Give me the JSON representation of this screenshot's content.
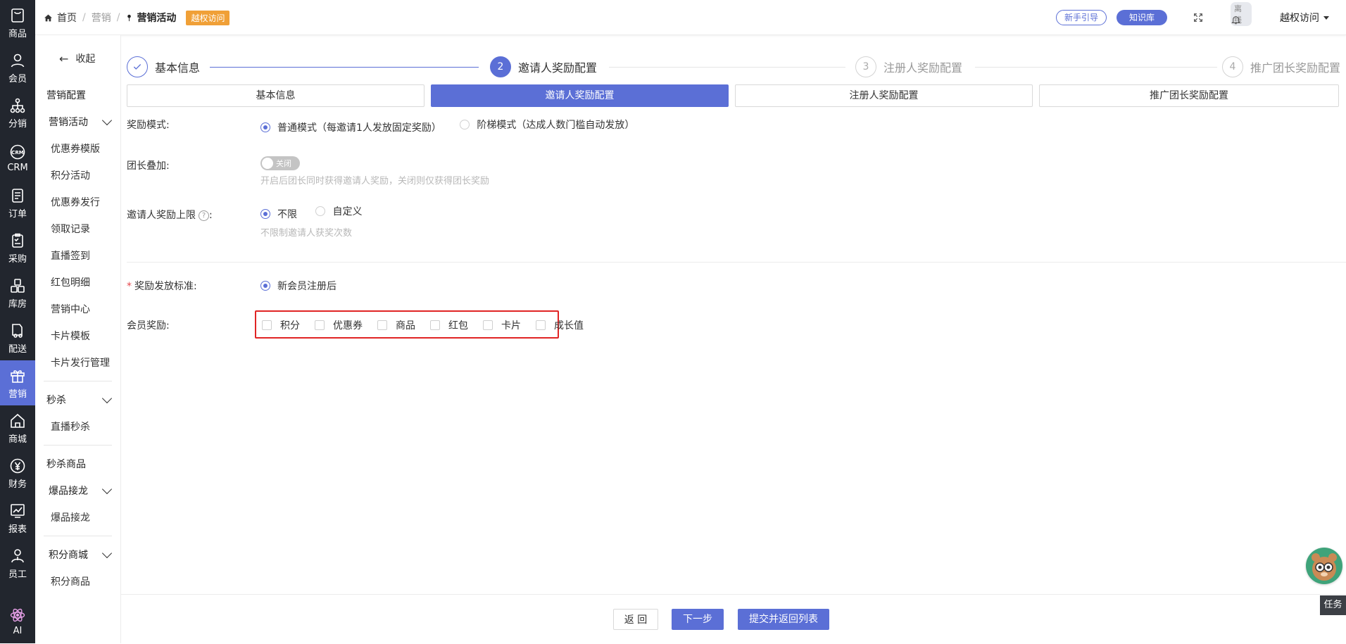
{
  "rail": {
    "items": [
      {
        "label": "商品",
        "icon": "bag-icon"
      },
      {
        "label": "会员",
        "icon": "user-icon"
      },
      {
        "label": "分销",
        "icon": "network-icon"
      },
      {
        "label": "CRM",
        "icon": "crm-icon"
      },
      {
        "label": "订单",
        "icon": "order-icon"
      },
      {
        "label": "采购",
        "icon": "purchase-icon"
      },
      {
        "label": "库房",
        "icon": "warehouse-icon"
      },
      {
        "label": "配送",
        "icon": "delivery-icon"
      },
      {
        "label": "营销",
        "icon": "gift-icon",
        "active": true
      },
      {
        "label": "商城",
        "icon": "home-icon"
      },
      {
        "label": "财务",
        "icon": "yuan-icon"
      },
      {
        "label": "报表",
        "icon": "chart-icon"
      },
      {
        "label": "员工",
        "icon": "staff-icon"
      }
    ],
    "ai_label": "AI"
  },
  "topbar": {
    "breadcrumb": [
      "首页",
      "营销",
      "营销活动"
    ],
    "badge": "越权访问",
    "guide_button": "新手引导",
    "knowledge_button": "知识库",
    "offline_tag": "离线",
    "user_menu": "越权访问"
  },
  "sidebar": {
    "collapse": "收起",
    "marketing_config": "营销配置",
    "group_activity": "营销活动",
    "activity_items": [
      "优惠券模版",
      "积分活动",
      "优惠券发行",
      "领取记录",
      "直播签到",
      "红包明细",
      "营销中心",
      "卡片模板",
      "卡片发行管理"
    ],
    "group_seckill": "秒杀",
    "seckill_items": [
      "直播秒杀"
    ],
    "seckill_goods": "秒杀商品",
    "group_chain": "爆品接龙",
    "chain_items": [
      "爆品接龙"
    ],
    "group_points": "积分商城",
    "points_items": [
      "积分商品"
    ]
  },
  "steps": [
    {
      "num": "",
      "label": "基本信息",
      "state": "done"
    },
    {
      "num": "2",
      "label": "邀请人奖励配置",
      "state": "active"
    },
    {
      "num": "3",
      "label": "注册人奖励配置",
      "state": "pending"
    },
    {
      "num": "4",
      "label": "推广团长奖励配置",
      "state": "pending"
    }
  ],
  "tabs": [
    "基本信息",
    "邀请人奖励配置",
    "注册人奖励配置",
    "推广团长奖励配置"
  ],
  "form": {
    "mode_label": "奖励模式:",
    "mode_option_normal": "普通模式（每邀请1人发放固定奖励）",
    "mode_option_ladder": "阶梯模式（达成人数门槛自动发放）",
    "leader_label": "团长叠加:",
    "toggle_text": "关闭",
    "leader_help": "开启后团长同时获得邀请人奖励，关闭则仅获得团长奖励",
    "limit_label": "邀请人奖励上限",
    "limit_colon": ":",
    "limit_option_unlimited": "不限",
    "limit_option_custom": "自定义",
    "limit_help": "不限制邀请人获奖次数",
    "standard_label": "奖励发放标准:",
    "standard_option": "新会员注册后",
    "member_reward_label": "会员奖励:",
    "reward_options": [
      "积分",
      "优惠券",
      "商品",
      "红包",
      "卡片",
      "成长值"
    ]
  },
  "footer": {
    "back": "返 回",
    "next": "下一步",
    "submit": "提交并返回列表"
  },
  "float": {
    "task_label": "任务"
  },
  "colors": {
    "accent": "#5b6fd6",
    "rail_bg": "#22262e",
    "highlight": "#e02424",
    "badge": "#f0a037"
  }
}
